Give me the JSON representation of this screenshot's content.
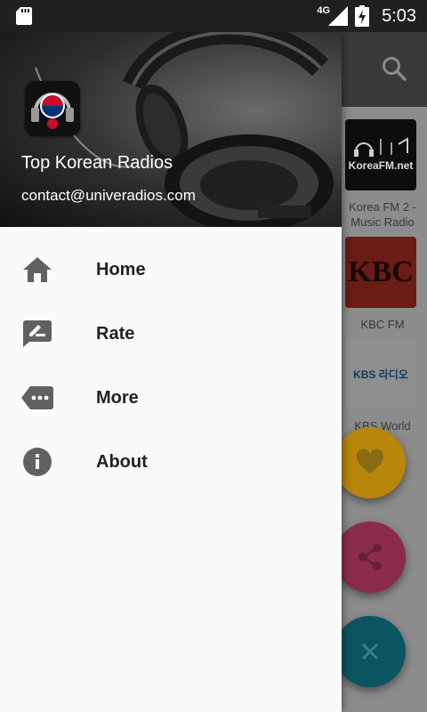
{
  "status_bar": {
    "network": "4G",
    "time": "5:03"
  },
  "drawer": {
    "title": "Top Korean Radios",
    "email": "contact@univeradios.com",
    "items": [
      {
        "label": "Home",
        "icon": "home-icon"
      },
      {
        "label": "Rate",
        "icon": "rate-review-icon"
      },
      {
        "label": "More",
        "icon": "more-tag-icon"
      },
      {
        "label": "About",
        "icon": "info-icon"
      }
    ]
  },
  "background": {
    "stations": [
      {
        "label": "Korea FM 2 - Music Radio",
        "logo_text": "KoreaFM.net"
      },
      {
        "label": "KBC FM",
        "logo_text": "KBC"
      },
      {
        "label": "KBS World Radio",
        "logo_text": "KBS 라디오"
      }
    ],
    "fabs": [
      {
        "icon": "heart-icon",
        "color": "#b8860b"
      },
      {
        "icon": "share-icon",
        "color": "#8b2b4c"
      },
      {
        "icon": "close-icon",
        "color": "#0b5560"
      }
    ]
  }
}
